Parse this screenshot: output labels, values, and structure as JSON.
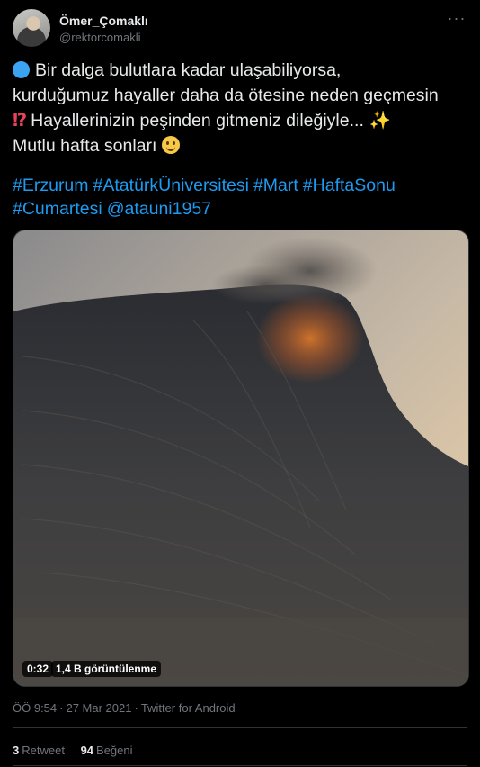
{
  "user": {
    "display_name": "Ömer_Çomaklı",
    "handle": "@rektorcomakli",
    "more_icon": "more-dots-icon"
  },
  "tweet": {
    "lines": [
      "Bir dalga bulutlara kadar ulaşabiliyorsa,",
      "kurduğumuz hayaller daha da ötesine neden geçmesin",
      "Hayallerinizin peşinden gitmeniz dileğiyle...",
      "Mutlu hafta sonları"
    ],
    "emojis": {
      "line1_prefix": "blue-circle",
      "line3_prefix": "⁉",
      "line3_suffix": "✨",
      "line4_suffix": "slightly-smiling-face"
    },
    "hashtags_line1": [
      "#Erzurum",
      "#AtatürkÜniversitesi",
      "#Mart",
      "#HaftaSonu"
    ],
    "hashtags_line2": [
      "#Cumartesi",
      "@atauni1957"
    ]
  },
  "media": {
    "duration": "0:32",
    "views": "1,4 B görüntülenme"
  },
  "meta": {
    "time": "ÖÖ 9:54",
    "date": "27 Mar 2021",
    "source": "Twitter for Android",
    "separator": "·"
  },
  "stats": {
    "retweets_count": "3",
    "retweets_label": "Retweet",
    "likes_count": "94",
    "likes_label": "Beğeni"
  },
  "colors": {
    "background": "#000000",
    "link": "#1d9bf0",
    "text": "#e7e9ea",
    "muted": "#71767b"
  }
}
